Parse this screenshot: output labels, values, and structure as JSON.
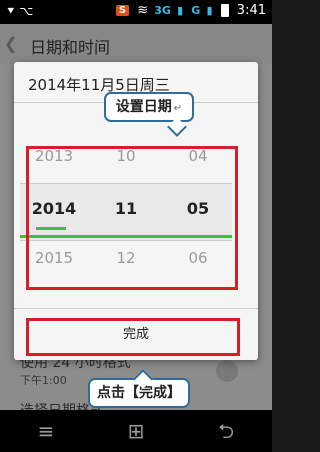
{
  "status_bar": {
    "badge": "S",
    "network": "3G",
    "network2": "G",
    "time": "3:41"
  },
  "background_app": {
    "title": "日期和时间",
    "row1_title": "使用 24 小时格式",
    "row1_sub": "下午1:00",
    "row3_title": "选择日期格式"
  },
  "dialog": {
    "title": "2014年11月5日周三",
    "columns": [
      {
        "prev": "2013",
        "current": "2014",
        "next": "2015"
      },
      {
        "prev": "10",
        "current": "11",
        "next": "12"
      },
      {
        "prev": "04",
        "current": "05",
        "next": "06"
      }
    ],
    "done_label": "完成"
  },
  "annotations": {
    "set_date": "设置日期",
    "click_done": "点击【完成】"
  },
  "colors": {
    "accent_green": "#3fbf3f",
    "highlight_red": "#d81e2b",
    "callout_border": "#2e6d99"
  },
  "navigation": {
    "menu_icon": "≡",
    "home_icon": "⊞",
    "back_icon": "⮌"
  }
}
